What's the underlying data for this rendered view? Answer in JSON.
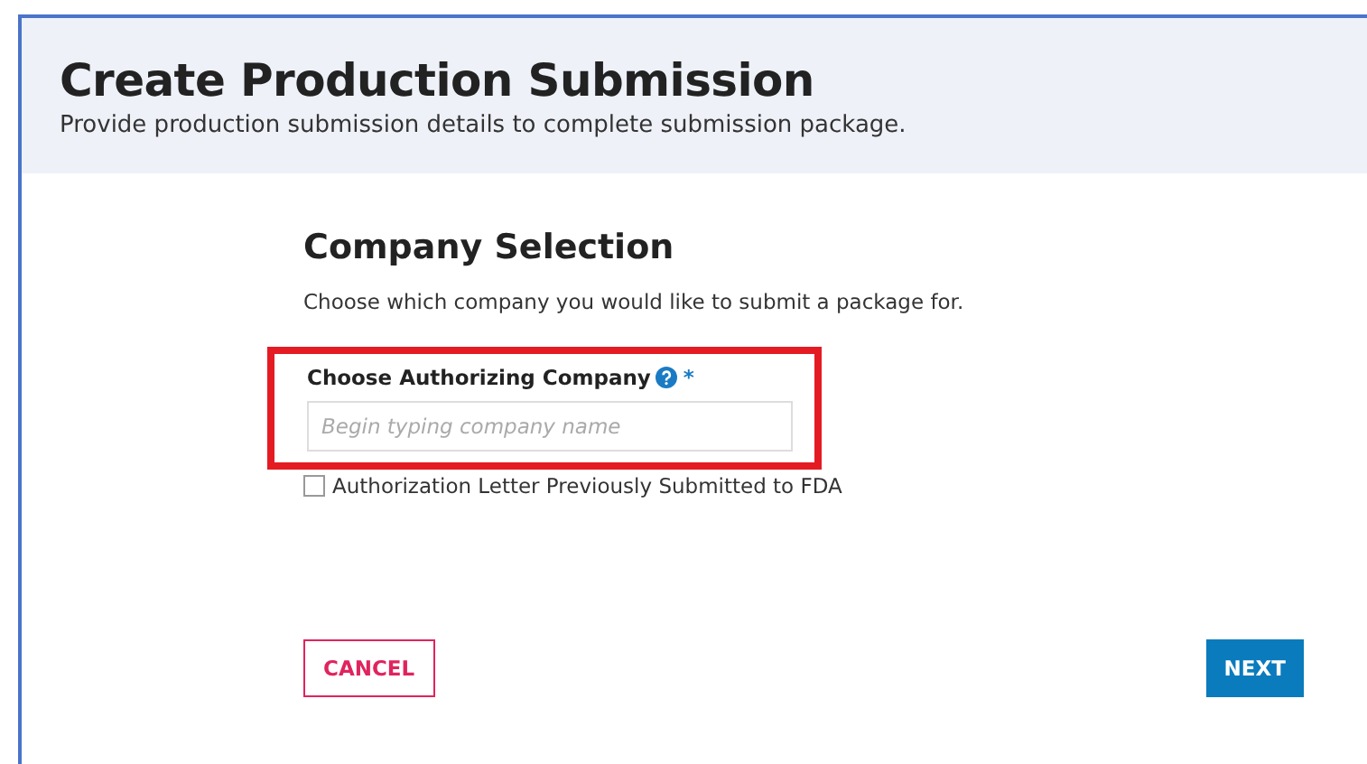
{
  "header": {
    "title": "Create Production Submission",
    "subtitle": "Provide production submission details to complete submission package."
  },
  "section": {
    "title": "Company Selection",
    "description": "Choose which company you would like to submit a package for."
  },
  "company_field": {
    "label": "Choose Authorizing Company",
    "required_mark": "*",
    "placeholder": "Begin typing company name",
    "highlighted": true
  },
  "checkbox": {
    "label": "Authorization Letter Previously Submitted to FDA",
    "checked": false
  },
  "buttons": [
    {
      "kind": "secondary",
      "label": "CANCEL"
    },
    {
      "kind": "primary",
      "label": "NEXT"
    }
  ]
}
